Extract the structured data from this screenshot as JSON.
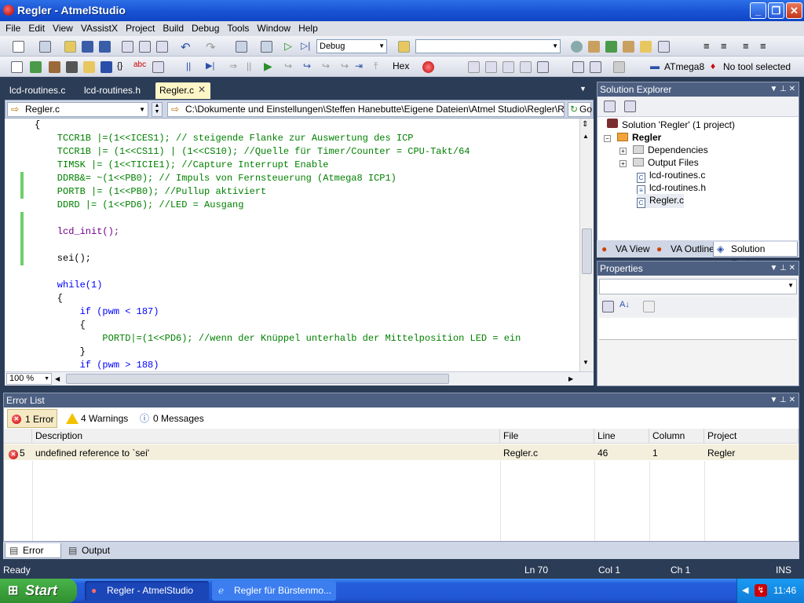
{
  "window": {
    "title": "Regler - AtmelStudio"
  },
  "menu": [
    "File",
    "Edit",
    "View",
    "VAssistX",
    "Project",
    "Build",
    "Debug",
    "Tools",
    "Window",
    "Help"
  ],
  "toolbar": {
    "config": "Debug",
    "search_value": "",
    "hex_label": "Hex",
    "device": "ATmega8",
    "tool": "No tool selected"
  },
  "tabs": [
    {
      "label": "lcd-routines.c"
    },
    {
      "label": "lcd-routines.h"
    },
    {
      "label": "Regler.c"
    }
  ],
  "nav": {
    "file": "Regler.c",
    "path": "C:\\Dokumente und Einstellungen\\Steffen Hanebutte\\Eigene Dateien\\Atmel Studio\\Regler\\Regler\\F",
    "go": "Go"
  },
  "code_lines": [
    "{",
    "    TCCR1B |=(1<<ICES1); // steigende Flanke zur Auswertung des ICP",
    "    TCCR1B |= (1<<CS11) | (1<<CS10); //Quelle für Timer/Counter = CPU-Takt/64",
    "    TIMSK |= (1<<TICIE1); //Capture Interrupt Enable",
    "    DDRB&= ~(1<<PB0); // Impuls von Fernsteuerung (Atmega8 ICP1)",
    "    PORTB |= (1<<PB0); //Pullup aktiviert",
    "    DDRD |= (1<<PD6); //LED = Ausgang",
    "",
    "    lcd_init();",
    "",
    "    sei();",
    "",
    "    while(1)",
    "    {",
    "        if (pwm < 187)",
    "        {",
    "            PORTD|=(1<<PD6); //wenn der Knüppel unterhalb der Mittelposition LED = ein",
    "        }",
    "        if (pwm > 188)"
  ],
  "zoom": "100 %",
  "solution": {
    "title": "Solution Explorer",
    "root": "Solution 'Regler' (1 project)",
    "project": "Regler",
    "items": [
      "Dependencies",
      "Output Files",
      "lcd-routines.c",
      "lcd-routines.h",
      "Regler.c"
    ],
    "tabs": [
      "VA View",
      "VA Outline",
      "Solution Explo..."
    ]
  },
  "properties": {
    "title": "Properties"
  },
  "errors": {
    "title": "Error List",
    "filters": {
      "errors": "1 Error",
      "warnings": "4 Warnings",
      "messages": "0 Messages"
    },
    "columns": [
      "Description",
      "File",
      "Line",
      "Column",
      "Project"
    ],
    "rows": [
      {
        "num": "5",
        "description": "undefined reference to `sei'",
        "file": "Regler.c",
        "line": "46",
        "column": "1",
        "project": "Regler"
      }
    ]
  },
  "bottom_tabs": [
    "Error List",
    "Output"
  ],
  "status": {
    "ready": "Ready",
    "ln": "Ln 70",
    "col": "Col 1",
    "ch": "Ch 1",
    "ins": "INS"
  },
  "taskbar": {
    "start": "Start",
    "items": [
      "Regler - AtmelStudio",
      "Regler für Bürstenmo..."
    ],
    "clock": "11:46"
  }
}
